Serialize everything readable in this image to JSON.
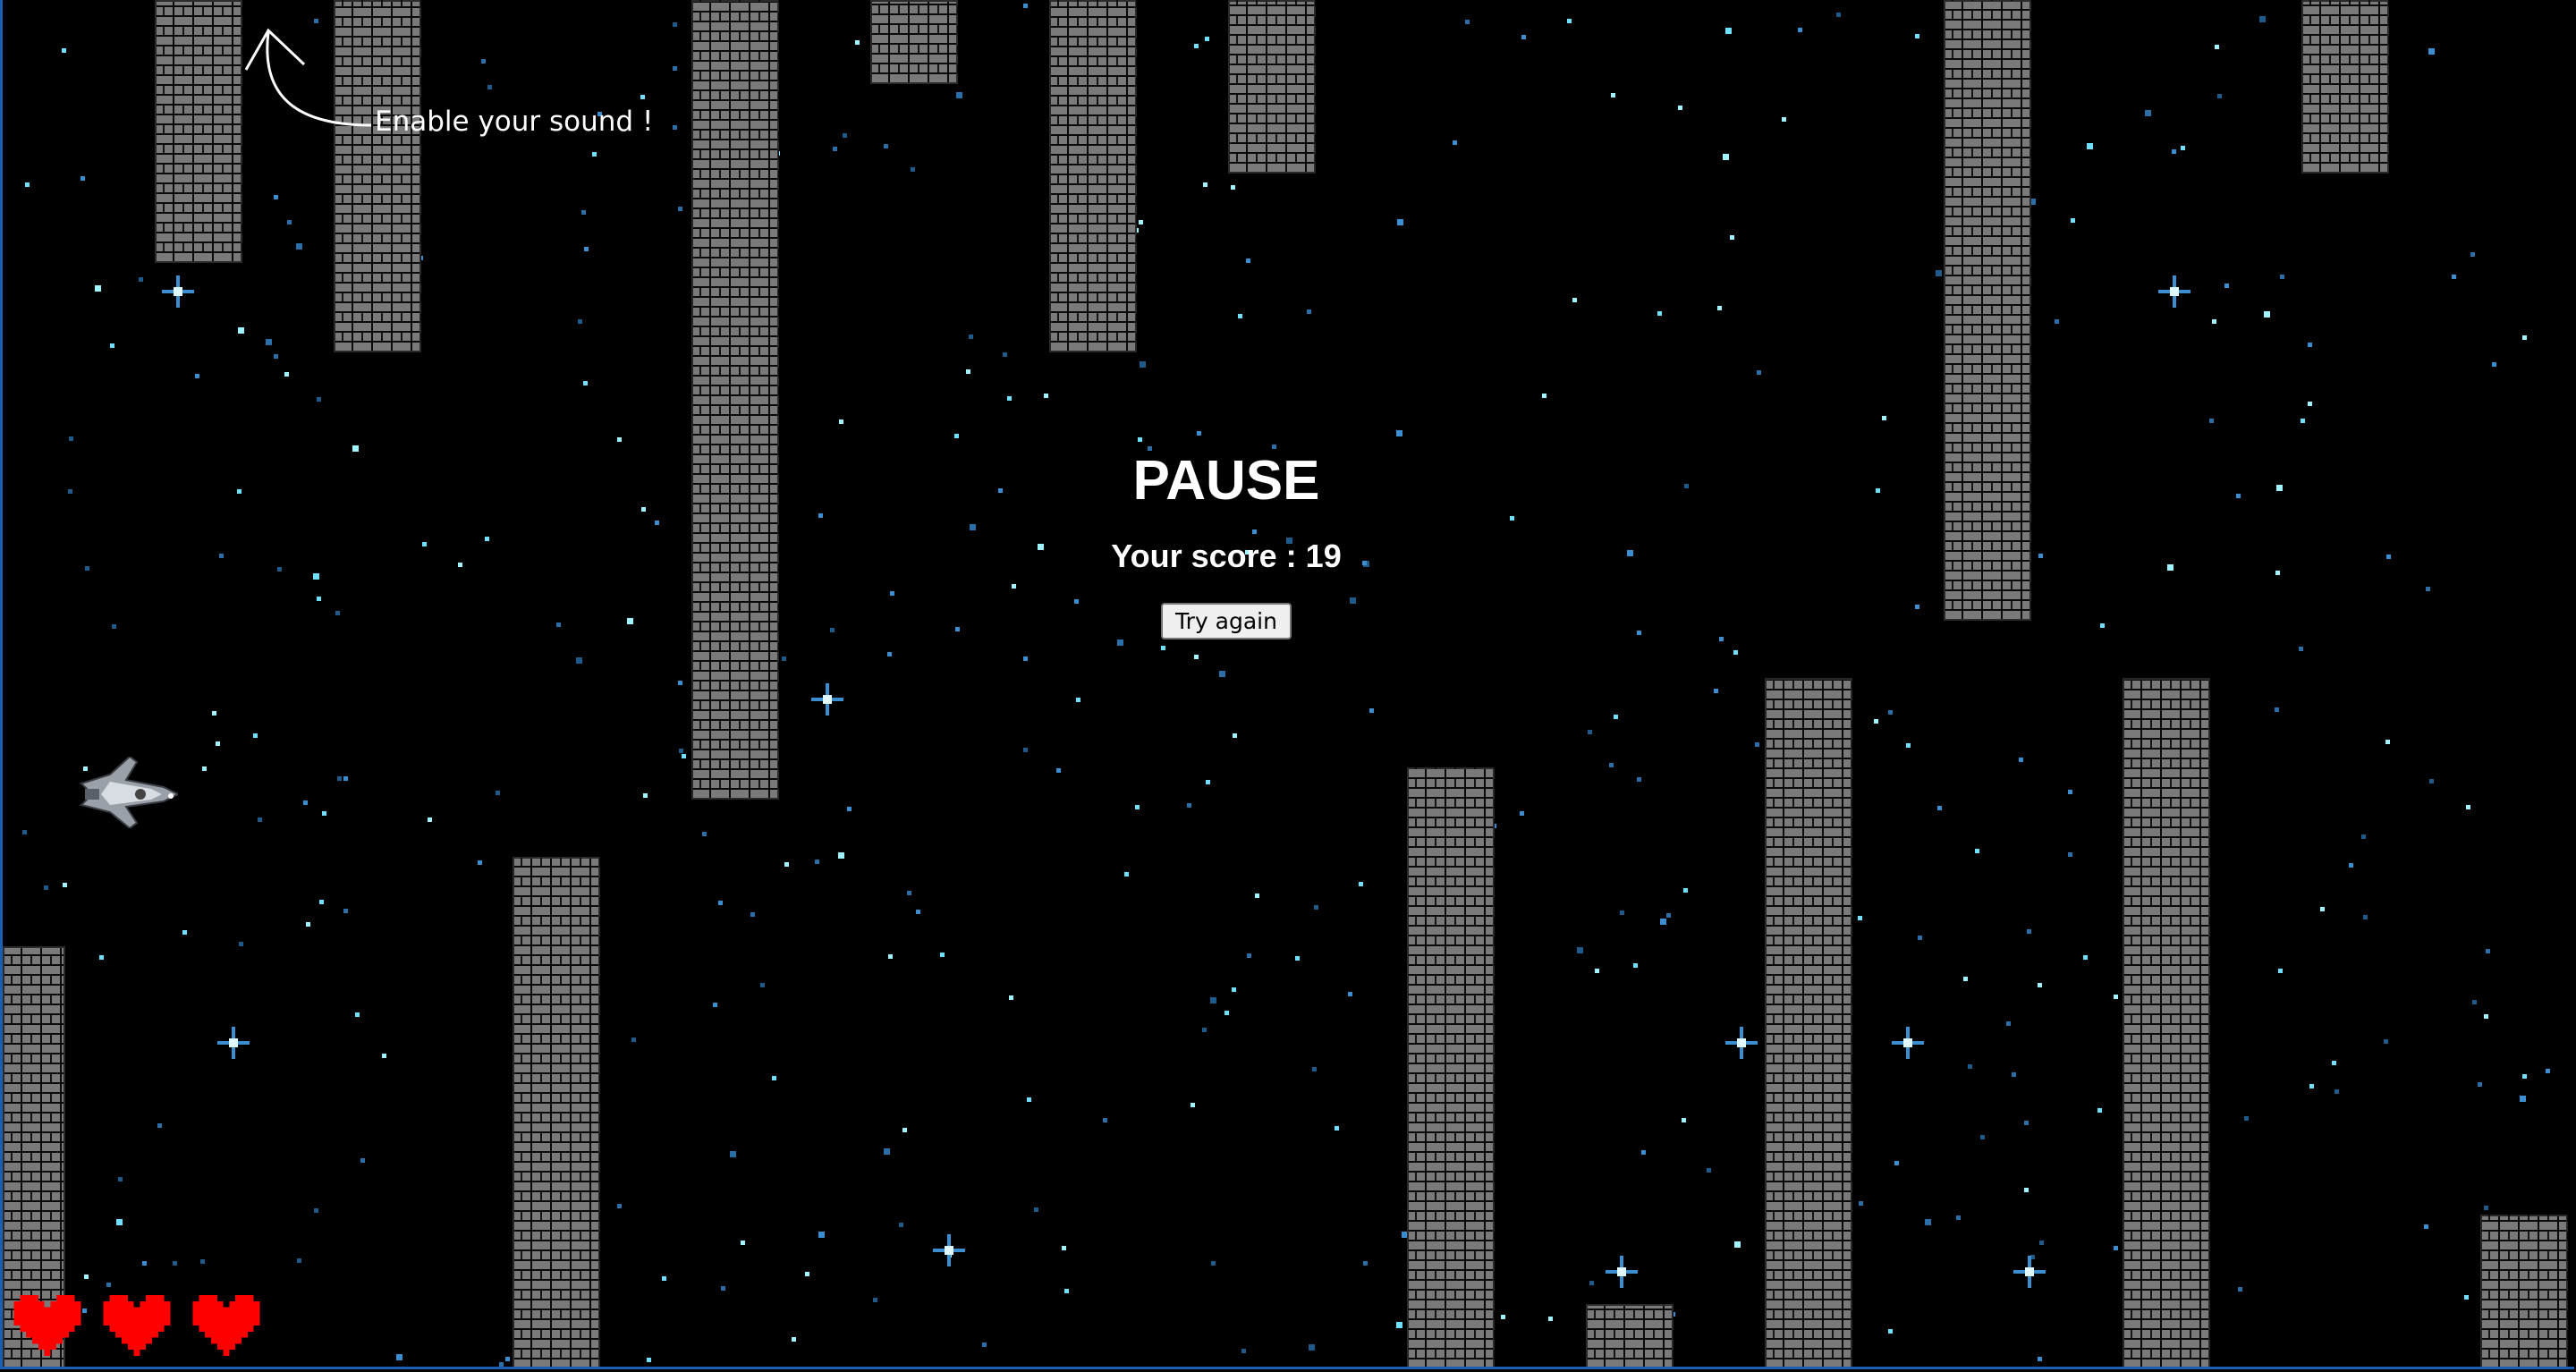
{
  "hint": {
    "text": "Enable your sound !"
  },
  "pause": {
    "title": "PAUSE",
    "score_text": "Your score : 19",
    "score": 19,
    "try_again_label": "Try again"
  },
  "lives": {
    "count": 3,
    "icon": "heart-icon"
  },
  "player": {
    "icon": "spaceship-icon"
  },
  "colors": {
    "background": "#000000",
    "brick": "#7a7a7a",
    "border": "#1a5fb4",
    "heart": "#ff0000",
    "star": "#6fe0ff"
  }
}
